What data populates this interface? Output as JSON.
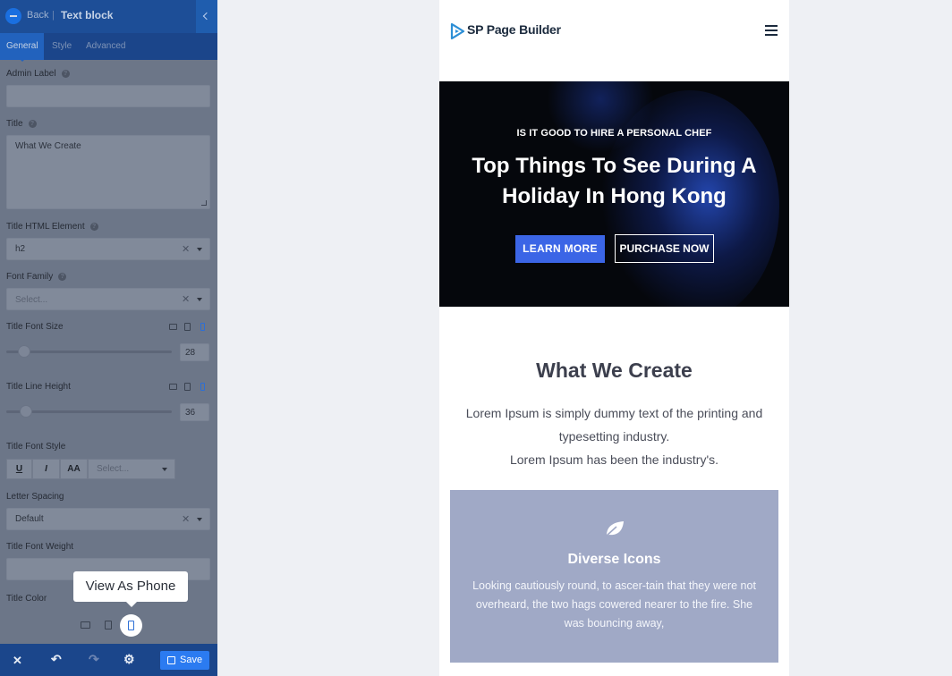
{
  "panel": {
    "back_label": "Back",
    "header_title": "Text block",
    "tabs": [
      {
        "label": "General",
        "active": true
      },
      {
        "label": "Style",
        "active": false
      },
      {
        "label": "Advanced",
        "active": false
      }
    ],
    "fields": {
      "admin_label": {
        "label": "Admin Label",
        "value": ""
      },
      "title": {
        "label": "Title",
        "value": "What We Create"
      },
      "title_html_element": {
        "label": "Title HTML Element",
        "value": "h2"
      },
      "font_family": {
        "label": "Font Family",
        "placeholder": "Select..."
      },
      "title_font_size": {
        "label": "Title Font Size",
        "value": "28"
      },
      "title_line_height": {
        "label": "Title Line Height",
        "value": "36"
      },
      "title_font_style": {
        "label": "Title Font Style",
        "underline": "U",
        "italic": "I",
        "uppercase": "AA",
        "select_placeholder": "Select..."
      },
      "letter_spacing": {
        "label": "Letter Spacing",
        "value": "Default"
      },
      "title_font_weight": {
        "label": "Title Font Weight",
        "value": ""
      },
      "title_color": {
        "label": "Title Color"
      }
    },
    "tooltip": "View As Phone",
    "save_label": "Save"
  },
  "preview": {
    "logo_text": "SP Page Builder",
    "hero": {
      "subtitle": "IS IT GOOD TO HIRE A PERSONAL CHEF",
      "title": "Top Things To See During A Holiday In Hong Kong",
      "primary_button": "LEARN MORE",
      "secondary_button": "PURCHASE NOW"
    },
    "section": {
      "title": "What We Create",
      "text_line1": "Lorem Ipsum is simply dummy text of the printing and typesetting industry.",
      "text_line2": "Lorem Ipsum has been the industry's."
    },
    "card": {
      "icon": "leaf-icon",
      "title": "Diverse Icons",
      "text": "Looking cautiously round, to ascer-tain that they were not overheard, the two hags cowered nearer to the fire. She was bouncing away,"
    }
  },
  "colors": {
    "panel_header": "#1d4e97",
    "accent_blue": "#2b7bf1",
    "hero_button": "#3b65e6",
    "card_bg": "#a0a9c6"
  }
}
